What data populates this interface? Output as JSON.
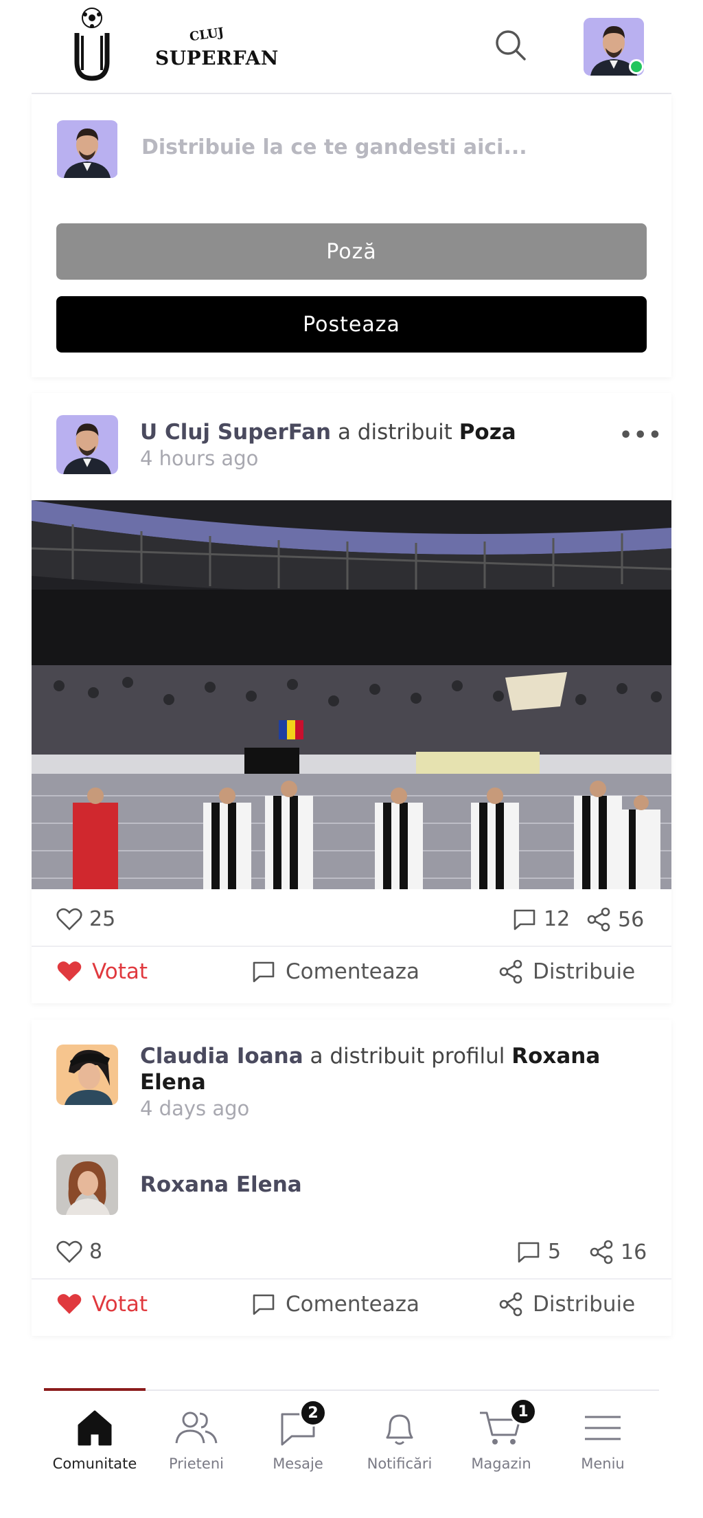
{
  "header": {
    "brand_top": "CLUJ",
    "brand_name": "SUPERFAN"
  },
  "composer": {
    "placeholder": "Distribuie la ce te gandesti aici...",
    "photo_button": "Poză",
    "post_button": "Posteaza"
  },
  "posts": [
    {
      "author": "U Cluj SuperFan",
      "verb": "a distribuit",
      "object": "Poza",
      "time": "4 hours ago",
      "likes": "25",
      "comments": "12",
      "shares": "56",
      "vote_label": "Votat",
      "comment_label": "Comenteaza",
      "share_label": "Distribuie"
    },
    {
      "author": "Claudia Ioana",
      "verb": "a distribuit profilul",
      "object": "Roxana",
      "object2": "Elena",
      "time": "4 days ago",
      "shared_name": "Roxana Elena",
      "likes": "8",
      "comments": "5",
      "shares": "16",
      "vote_label": "Votat",
      "comment_label": "Comenteaza",
      "share_label": "Distribuie"
    }
  ],
  "nav": {
    "items": [
      {
        "label": "Comunitate",
        "icon": "home-icon"
      },
      {
        "label": "Prieteni",
        "icon": "friends-icon"
      },
      {
        "label": "Mesaje",
        "icon": "messages-icon",
        "badge": "2"
      },
      {
        "label": "Notificări",
        "icon": "bell-icon"
      },
      {
        "label": "Magazin",
        "icon": "cart-icon",
        "badge": "1"
      },
      {
        "label": "Meniu",
        "icon": "menu-icon"
      }
    ]
  },
  "colors": {
    "accent": "#8b1c1c",
    "voted": "#e0393e",
    "online": "#22c55e",
    "avatar_bg": "#b9b0f0"
  }
}
